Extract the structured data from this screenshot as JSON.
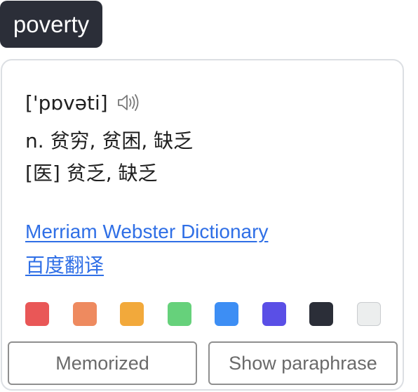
{
  "word": "poverty",
  "phonetic": "['pɒvəti]",
  "speaker_icon": "speaker-icon",
  "definitions": [
    "n. 贫穷, 贫困, 缺乏",
    "[医] 贫乏, 缺乏"
  ],
  "links": [
    "Merriam Webster Dictionary",
    "百度翻译"
  ],
  "color_swatches": [
    {
      "name": "red",
      "color": "#e95757"
    },
    {
      "name": "orange",
      "color": "#ee8a5f"
    },
    {
      "name": "yellow",
      "color": "#f2a93b"
    },
    {
      "name": "green",
      "color": "#66d17b"
    },
    {
      "name": "blue",
      "color": "#3d8ef4"
    },
    {
      "name": "purple",
      "color": "#5a4fe6"
    },
    {
      "name": "dark",
      "color": "#2b2e38"
    },
    {
      "name": "light-gray",
      "color": "#eceeee"
    }
  ],
  "buttons": {
    "memorized_label": "Memorized",
    "show_paraphrase_label": "Show paraphrase"
  }
}
